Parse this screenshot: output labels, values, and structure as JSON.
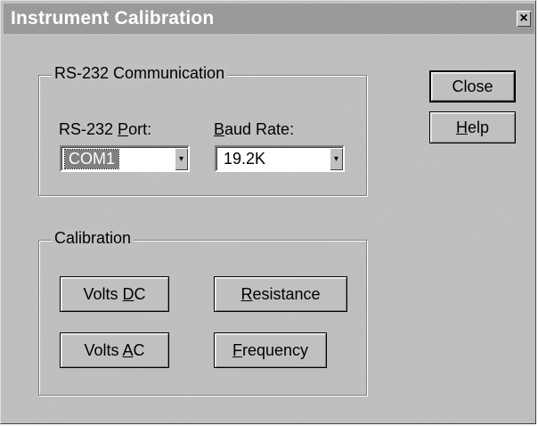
{
  "window": {
    "title": "Instrument Calibration",
    "close_glyph": "×"
  },
  "rs232_group": {
    "legend": "RS-232 Communication",
    "port_label": {
      "before": "RS-232 ",
      "accel": "P",
      "after": "ort:"
    },
    "port_value": "COM1",
    "baud_label": {
      "before": "",
      "accel": "B",
      "after": "aud Rate:"
    },
    "baud_value": "19.2K",
    "dropdown_glyph": "▾"
  },
  "calibration_group": {
    "legend": "Calibration",
    "volts_dc": {
      "before": "Volts ",
      "accel": "D",
      "after": "C"
    },
    "resistance": {
      "before": "",
      "accel": "R",
      "after": "esistance"
    },
    "volts_ac": {
      "before": "Volts ",
      "accel": "A",
      "after": "C"
    },
    "frequency": {
      "before": "",
      "accel": "F",
      "after": "requency"
    }
  },
  "side_buttons": {
    "close_label": "Close",
    "help": {
      "before": "",
      "accel": "H",
      "after": "elp"
    }
  },
  "icons": {
    "close": "close-icon",
    "dropdown": "chevron-down-icon"
  }
}
